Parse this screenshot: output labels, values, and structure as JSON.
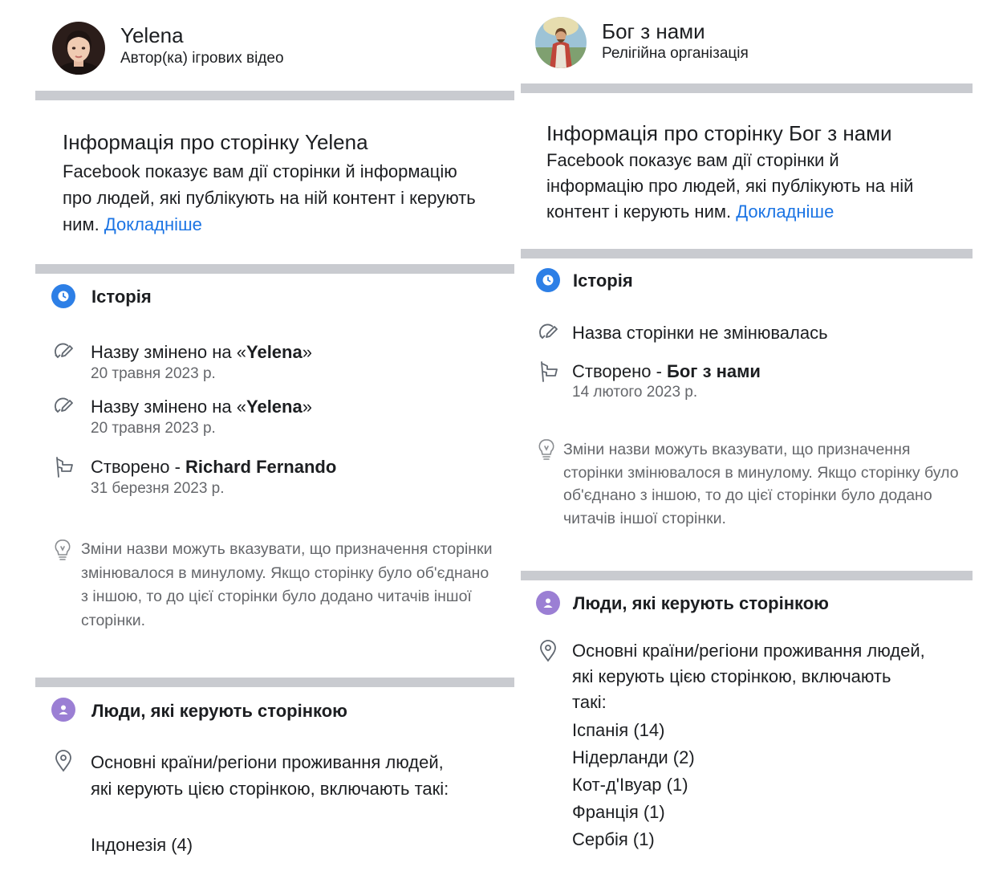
{
  "left": {
    "page_name": "Yelena",
    "category": "Автор(ка) ігрових відео",
    "info_title": "Інформація про сторінку Yelena",
    "info_body": "Facebook показує вам дії сторінки й інформацію про людей, які публікують на ній контент і керують ним.",
    "info_link": "Докладніше",
    "history_title": "Історія",
    "history": [
      {
        "prefix": "Назву змінено на «",
        "bold": "Yelena",
        "suffix": "»",
        "date": "20 травня 2023 р."
      },
      {
        "prefix": "Назву змінено на «",
        "bold": "Yelena",
        "suffix": "»",
        "date": "20 травня 2023 р."
      },
      {
        "prefix": "Створено - ",
        "bold": "Richard Fernando",
        "suffix": "",
        "date": "31 березня 2023 р."
      }
    ],
    "tip": "Зміни назви можуть вказувати, що призначення сторінки змінювалося в минулому. Якщо сторінку було об'єднано з іншою, то до цієї сторінки було додано читачів іншої сторінки.",
    "people_title": "Люди, які керують сторінкою",
    "countries_text": "Основні країни/регіони проживання людей, які керують цією сторінкою, включають такі:",
    "countries": [
      "Індонезія (4)"
    ]
  },
  "right": {
    "page_name": "Бог з нами",
    "category": "Релігійна організація",
    "info_title": "Інформація про сторінку Бог з нами",
    "info_body": "Facebook показує вам дії сторінки й інформацію про людей, які публікують на ній контент і керують ним.",
    "info_link": "Докладніше",
    "history_title": "Історія",
    "name_unchanged": "Назва сторінки не змінювалась",
    "created": {
      "prefix": "Створено - ",
      "bold": "Бог з нами",
      "date": "14 лютого 2023 р."
    },
    "tip": "Зміни назви можуть вказувати, що призначення сторінки змінювалося в минулому. Якщо сторінку було об'єднано з іншою, то до цієї сторінки було додано читачів іншої сторінки.",
    "people_title": "Люди, які керують сторінкою",
    "countries_text": "Основні країни/регіони проживання людей, які керують цією сторінкою, включають такі:",
    "countries": [
      "Іспанія (14)",
      "Нідерланди (2)",
      "Кот-д'Івуар (1)",
      "Франція (1)",
      "Сербія (1)"
    ]
  },
  "colors": {
    "link": "#1b74e4",
    "history_icon": "#2d7fe6",
    "people_icon": "#9b7fd4",
    "divider": "#c9cbd0",
    "secondary_text": "#65676b"
  },
  "icons": {
    "history": "clock-icon",
    "name_change": "edit-pencil-icon",
    "created": "flag-icon",
    "tip": "lightbulb-icon",
    "people": "person-icon",
    "location": "location-pin-icon"
  }
}
